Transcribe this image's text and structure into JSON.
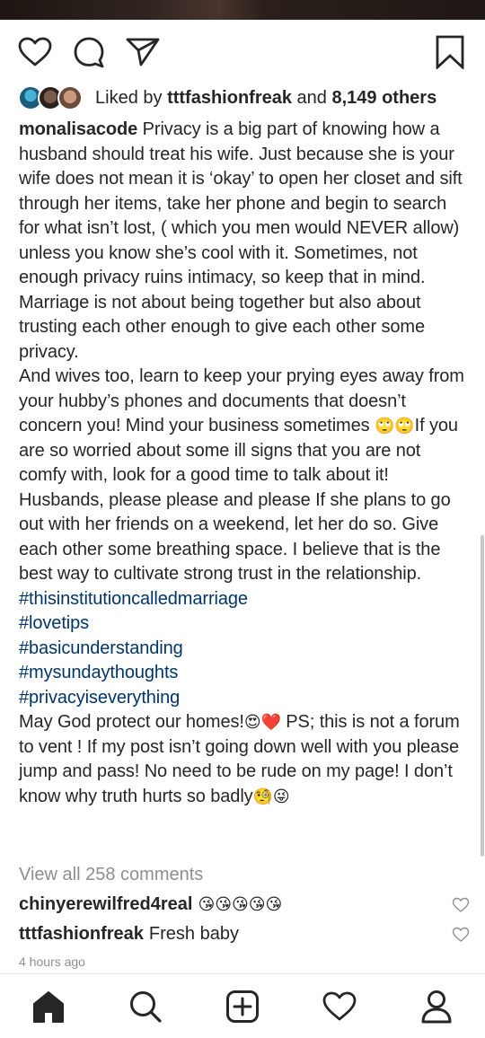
{
  "post": {
    "liked_by_prefix": "Liked by",
    "liked_by_user": "tttfashionfreak",
    "liked_by_and": "and",
    "liked_by_others": "8,149 others",
    "caption": {
      "username": "monalisacode",
      "paragraph1": "Privacy is a big part of knowing how a husband should treat his wife. Just because she is your wife does not mean it is ‘okay’ to open her closet and sift through her items, take her phone and begin to search for what isn’t lost, ( which you men would NEVER allow) unless you know she’s cool with it. Sometimes, not enough privacy ruins intimacy, so keep that in mind. Marriage is not about being together but also about trusting each other enough to give each other some privacy.",
      "paragraph2_a": "And wives too, learn to keep your prying eyes away from your hubby’s phones and documents that doesn’t concern you! Mind your business sometimes",
      "paragraph2_emoji": "🙄🙄",
      "paragraph2_b": "If you are so worried about some ill signs that you are not comfy with, look for a good time to talk about it!",
      "paragraph3": "Husbands, please please and please If she plans to go out with her friends on a weekend, let her do so. Give each other some breathing space. I believe that is the best way to cultivate strong trust in the relationship.",
      "hashtags": [
        "#thisinstitutioncalledmarriage",
        "#lovetips",
        "#basicunderstanding",
        "#mysundaythoughts",
        "#privacyiseverything"
      ],
      "paragraph4_a": "May God protect our homes!",
      "paragraph4_emoji1": "😍❤️",
      "paragraph4_b": " PS; this is not a forum to vent ! If my post isn’t going down well with you please jump and pass! No need to be rude on my page! I don’t know why truth hurts so badly",
      "paragraph4_emoji2": "🧐😜"
    },
    "view_all_comments": "View all 258 comments",
    "comments": [
      {
        "username": "chinyerewilfred4real",
        "text": "😘😘😘😘😘"
      },
      {
        "username": "tttfashionfreak",
        "text": "Fresh baby"
      }
    ],
    "timestamp": "4 hours ago"
  },
  "icons": {
    "like": "heart-outline-icon",
    "comment": "comment-bubble-icon",
    "share": "paper-plane-icon",
    "save": "bookmark-icon",
    "nav_home": "home-icon",
    "nav_search": "search-icon",
    "nav_add": "add-post-icon",
    "nav_activity": "heart-icon",
    "nav_profile": "profile-icon"
  },
  "colors": {
    "text": "#262626",
    "hashtag": "#003569",
    "muted": "#8e8e8e"
  }
}
